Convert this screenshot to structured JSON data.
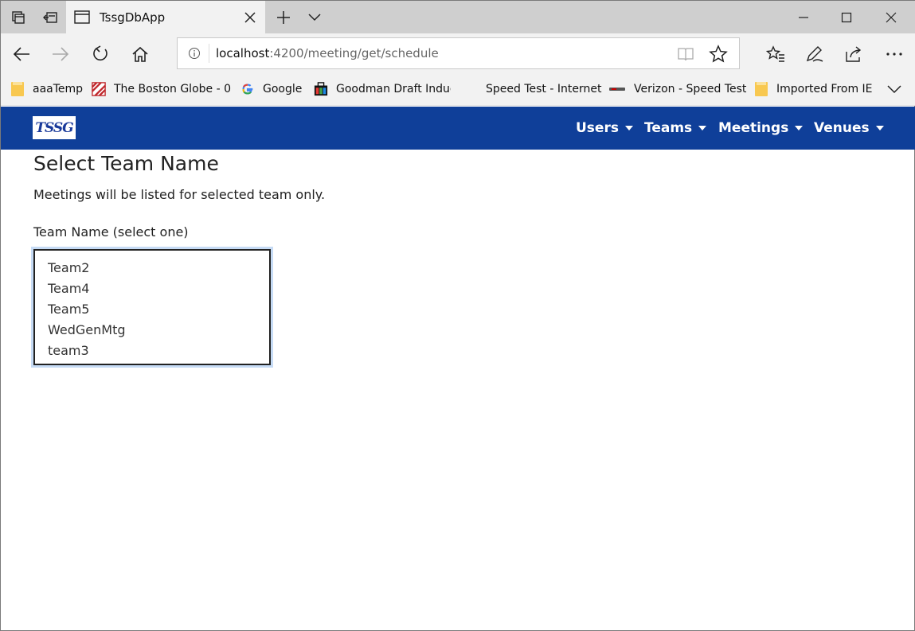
{
  "browser": {
    "tab_title": "TssgDbApp",
    "url_host": "localhost",
    "url_path": ":4200/meeting/get/schedule"
  },
  "favorites": [
    {
      "label": "aaaTemp",
      "icon": "folder-icon"
    },
    {
      "label": "The Boston Globe - 0",
      "icon": "boston-globe-icon"
    },
    {
      "label": "Google",
      "icon": "google-icon"
    },
    {
      "label": "Goodman Draft Induc",
      "icon": "goodman-icon"
    },
    {
      "label": "Speed Test - Internet",
      "icon": ""
    },
    {
      "label": "Verizon - Speed Test",
      "icon": "verizon-icon"
    },
    {
      "label": "Imported From IE",
      "icon": "folder-icon"
    }
  ],
  "app": {
    "logo_text": "TSSG",
    "menu": [
      "Users",
      "Teams",
      "Meetings",
      "Venues"
    ]
  },
  "page": {
    "title": "Select Team Name",
    "subtitle": "Meetings will be listed for selected team only.",
    "field_label": "Team Name (select one)",
    "options": [
      "Team2",
      "Team4",
      "Team5",
      "WedGenMtg",
      "team3"
    ]
  },
  "colors": {
    "app_header": "#0f3f99",
    "chrome_bg": "#f2f2f2"
  }
}
